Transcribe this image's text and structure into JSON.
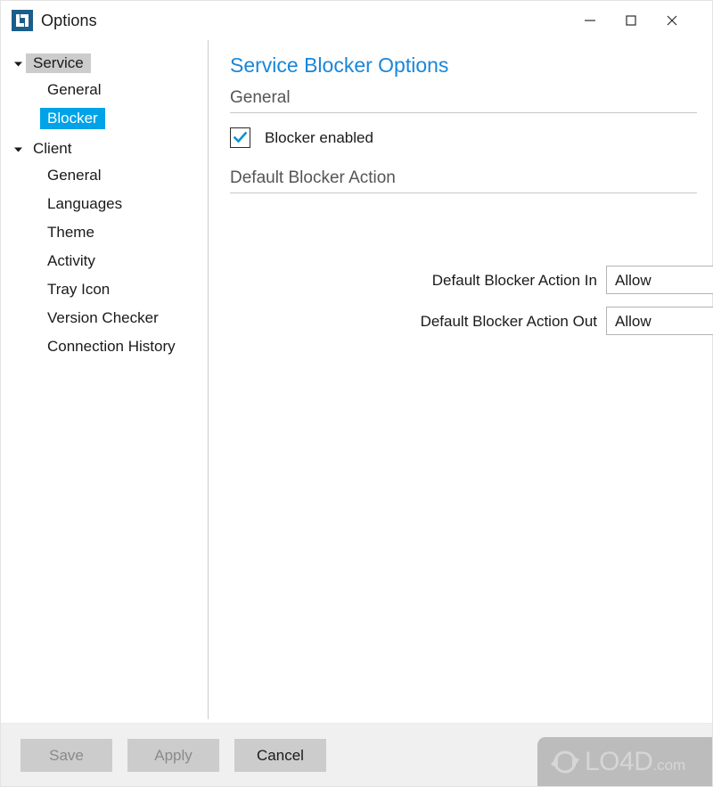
{
  "window": {
    "title": "Options",
    "app_icon": "app-logo-icon",
    "controls": [
      {
        "name": "minimize-button",
        "icon": "minimize-icon"
      },
      {
        "name": "maximize-button",
        "icon": "maximize-icon"
      },
      {
        "name": "close-button",
        "icon": "close-icon"
      }
    ]
  },
  "sidebar": {
    "groups": [
      {
        "label": "Service",
        "expanded": true,
        "highlighted": true,
        "twisty_icon": "chevron-down-icon",
        "children": [
          {
            "label": "General",
            "selected": false
          },
          {
            "label": "Blocker",
            "selected": true
          }
        ]
      },
      {
        "label": "Client",
        "expanded": true,
        "highlighted": false,
        "twisty_icon": "chevron-down-icon",
        "children": [
          {
            "label": "General",
            "selected": false
          },
          {
            "label": "Languages",
            "selected": false
          },
          {
            "label": "Theme",
            "selected": false
          },
          {
            "label": "Activity",
            "selected": false
          },
          {
            "label": "Tray Icon",
            "selected": false
          },
          {
            "label": "Version Checker",
            "selected": false
          },
          {
            "label": "Connection History",
            "selected": false
          }
        ]
      }
    ]
  },
  "main": {
    "page_title": "Service Blocker Options",
    "sections": {
      "general": {
        "header": "General",
        "checkbox": {
          "label": "Blocker enabled",
          "checked": true,
          "icon": "checkmark-icon"
        }
      },
      "default_action": {
        "header": "Default Blocker Action",
        "fields": [
          {
            "label": "Default Blocker Action In",
            "value": "Allow",
            "arrow_icon": "triangle-down-icon"
          },
          {
            "label": "Default Blocker Action Out",
            "value": "Allow",
            "arrow_icon": "triangle-down-icon"
          }
        ]
      }
    }
  },
  "footer": {
    "buttons": [
      {
        "label": "Save",
        "enabled": false
      },
      {
        "label": "Apply",
        "enabled": false
      },
      {
        "label": "Cancel",
        "enabled": true
      }
    ],
    "watermark": {
      "text_main": "LO4D",
      "text_suffix": ".com",
      "logo_icon": "refresh-circle-icon"
    }
  },
  "colors": {
    "accent_blue": "#1a86d8",
    "selection_blue": "#00a2e8",
    "highlight_grey": "#cccccc",
    "footer_bg": "#f0f0f0",
    "icon_blue": "#1b5e8c"
  }
}
